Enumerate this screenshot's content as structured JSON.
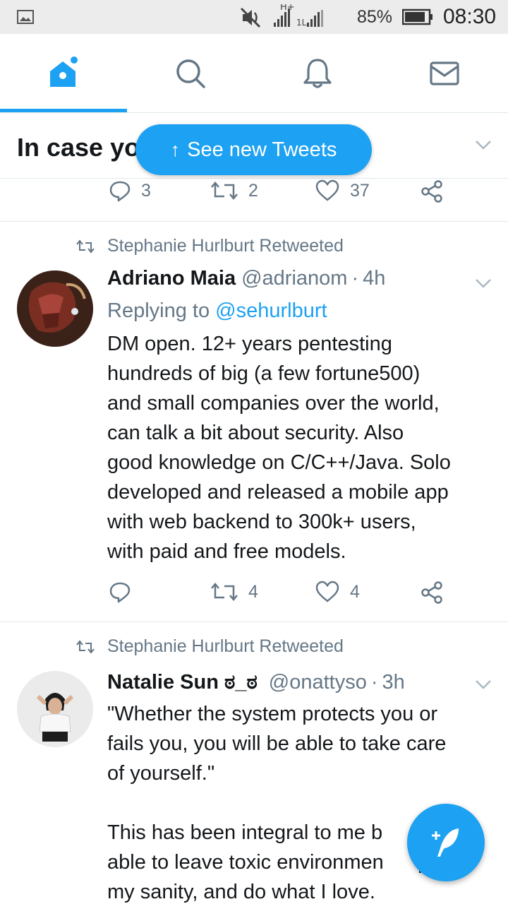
{
  "status_bar": {
    "network_label": "H+",
    "battery_percent": "85%",
    "time": "08:30"
  },
  "nav": {
    "tabs": [
      {
        "name": "home",
        "icon": "home-icon",
        "active": true
      },
      {
        "name": "search",
        "icon": "search-icon",
        "active": false
      },
      {
        "name": "notifications",
        "icon": "bell-icon",
        "active": false
      },
      {
        "name": "messages",
        "icon": "mail-icon",
        "active": false
      }
    ]
  },
  "section": {
    "title": "In case you"
  },
  "new_tweets_pill": {
    "label": "See new Tweets",
    "icon": "arrow-up-icon"
  },
  "first_tweet_actions": {
    "replies": "3",
    "retweets": "2",
    "likes": "37"
  },
  "tweets": [
    {
      "retweeted_by": "Stephanie Hurlburt Retweeted",
      "name": "Adriano Maia",
      "handle": "@adrianom",
      "separator": "·",
      "time": "4h",
      "replying_prefix": "Replying to",
      "replying_to": "@sehurlburt",
      "text": "DM open. 12+ years pentesting\nhundreds of big (a few fortune500)\nand small companies over the world,\ncan talk a bit about security. Also\ngood knowledge on C/C++/Java. Solo\ndeveloped and released a mobile app\nwith web backend to 300k+ users,\nwith paid and free models.",
      "retweets": "4",
      "likes": "4"
    },
    {
      "retweeted_by": "Stephanie Hurlburt Retweeted",
      "name": "Natalie Sun ಠ_ಠ",
      "handle": "@onattyso",
      "separator": "·",
      "time": "3h",
      "text": "\"Whether the system protects you or\nfails you, you will be able to take care\nof yourself.\"\n\nThis has been integral to me b\nable to leave toxic environmen      p\nmy sanity, and do what I love."
    }
  ],
  "colors": {
    "accent": "#1da1f2",
    "text_primary": "#14171a",
    "text_secondary": "#657786",
    "divider": "#e1e8ed"
  }
}
